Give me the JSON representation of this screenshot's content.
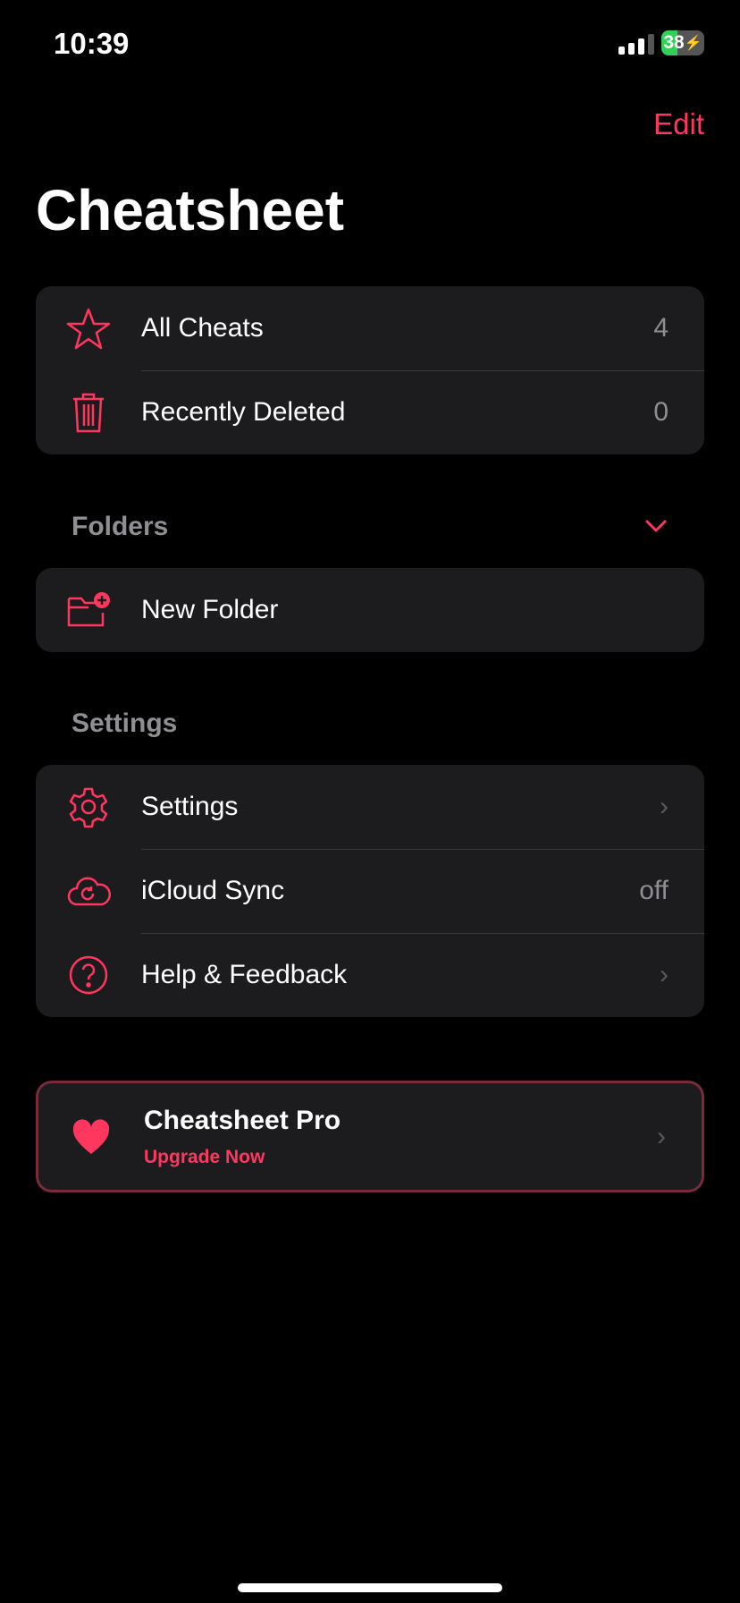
{
  "status": {
    "time": "10:39",
    "battery": "38",
    "battery_level_percent": 38
  },
  "nav": {
    "edit": "Edit",
    "title": "Cheatsheet"
  },
  "library": [
    {
      "icon": "star-icon",
      "label": "All Cheats",
      "count": "4"
    },
    {
      "icon": "trash-icon",
      "label": "Recently Deleted",
      "count": "0"
    }
  ],
  "folders": {
    "header": "Folders",
    "new_folder": "New Folder"
  },
  "settings": {
    "header": "Settings",
    "items": [
      {
        "icon": "gear-icon",
        "label": "Settings"
      },
      {
        "icon": "icloud-sync-icon",
        "label": "iCloud Sync",
        "value": "off"
      },
      {
        "icon": "question-icon",
        "label": "Help & Feedback"
      }
    ]
  },
  "pro": {
    "title": "Cheatsheet Pro",
    "subtitle": "Upgrade Now"
  },
  "colors": {
    "accent": "#ff375f",
    "card": "#1c1c1e"
  }
}
